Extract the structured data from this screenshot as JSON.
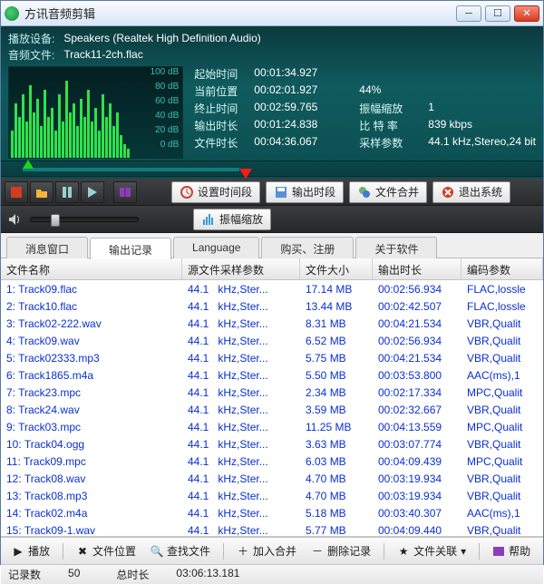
{
  "window": {
    "title": "方讯音频剪辑"
  },
  "device": {
    "play_label": "播放设备:",
    "play_value": "Speakers (Realtek High Definition Audio)",
    "file_label": "音频文件:",
    "file_value": "Track11-2ch.flac"
  },
  "db_labels": [
    "100 dB",
    "80 dB",
    "60 dB",
    "40 dB",
    "20 dB",
    "0 dB"
  ],
  "kv": {
    "start_k": "起始时间",
    "start_v": "00:01:34.927",
    "pos_k": "当前位置",
    "pos_v": "00:02:01.927",
    "pct_v": "44%",
    "end_k": "终止时间",
    "end_v": "00:02:59.765",
    "amp_k": "振幅缩放",
    "amp_v": "1",
    "out_k": "输出时长",
    "out_v": "00:01:24.838",
    "br_k": "比 特 率",
    "br_v": "839 kbps",
    "len_k": "文件时长",
    "len_v": "00:04:36.067",
    "samp_k": "采样参数",
    "samp_v": "44.1  kHz,Stereo,24 bit"
  },
  "menu": {
    "settime": "设置时间段",
    "outseg": "输出时段",
    "merge": "文件合并",
    "exit": "退出系统",
    "amp": "振幅缩放"
  },
  "tabs": [
    "消息窗口",
    "输出记录",
    "Language",
    "购买、注册",
    "关于软件"
  ],
  "cols": {
    "name": "文件名称",
    "src": "源文件采样参数",
    "size": "文件大小",
    "dur": "输出时长",
    "enc": "编码参数"
  },
  "rows": [
    {
      "i": "1:",
      "n": "Track09.flac",
      "hz": "44.1",
      "fmt": "kHz,Ster...",
      "sz": "17.14 MB",
      "d": "00:02:56.934",
      "e": "FLAC,lossle"
    },
    {
      "i": "2:",
      "n": "Track10.flac",
      "hz": "44.1",
      "fmt": "kHz,Ster...",
      "sz": "13.44 MB",
      "d": "00:02:42.507",
      "e": "FLAC,lossle"
    },
    {
      "i": "3:",
      "n": "Track02-222.wav",
      "hz": "44.1",
      "fmt": "kHz,Ster...",
      "sz": "8.31 MB",
      "d": "00:04:21.534",
      "e": "VBR,Qualit"
    },
    {
      "i": "4:",
      "n": "Track09.wav",
      "hz": "44.1",
      "fmt": "kHz,Ster...",
      "sz": "6.52 MB",
      "d": "00:02:56.934",
      "e": "VBR,Qualit"
    },
    {
      "i": "5:",
      "n": "Track02333.mp3",
      "hz": "44.1",
      "fmt": "kHz,Ster...",
      "sz": "5.75 MB",
      "d": "00:04:21.534",
      "e": "VBR,Qualit"
    },
    {
      "i": "6:",
      "n": "Track1865.m4a",
      "hz": "44.1",
      "fmt": "kHz,Ster...",
      "sz": "5.50 MB",
      "d": "00:03:53.800",
      "e": "AAC(ms),1"
    },
    {
      "i": "7:",
      "n": "Track23.mpc",
      "hz": "44.1",
      "fmt": "kHz,Ster...",
      "sz": "2.34 MB",
      "d": "00:02:17.334",
      "e": "MPC,Qualit"
    },
    {
      "i": "8:",
      "n": "Track24.wav",
      "hz": "44.1",
      "fmt": "kHz,Ster...",
      "sz": "3.59 MB",
      "d": "00:02:32.667",
      "e": "VBR,Qualit"
    },
    {
      "i": "9:",
      "n": "Track03.mpc",
      "hz": "44.1",
      "fmt": "kHz,Ster...",
      "sz": "11.25 MB",
      "d": "00:04:13.559",
      "e": "MPC,Qualit"
    },
    {
      "i": "10:",
      "n": "Track04.ogg",
      "hz": "44.1",
      "fmt": "kHz,Ster...",
      "sz": "3.63 MB",
      "d": "00:03:07.774",
      "e": "VBR,Qualit"
    },
    {
      "i": "11:",
      "n": "Track09.mpc",
      "hz": "44.1",
      "fmt": "kHz,Ster...",
      "sz": "6.03 MB",
      "d": "00:04:09.439",
      "e": "MPC,Qualit"
    },
    {
      "i": "12:",
      "n": "Track08.wav",
      "hz": "44.1",
      "fmt": "kHz,Ster...",
      "sz": "4.70 MB",
      "d": "00:03:19.934",
      "e": "VBR,Qualit"
    },
    {
      "i": "13:",
      "n": "Track08.mp3",
      "hz": "44.1",
      "fmt": "kHz,Ster...",
      "sz": "4.70 MB",
      "d": "00:03:19.934",
      "e": "VBR,Qualit"
    },
    {
      "i": "14:",
      "n": "Track02.m4a",
      "hz": "44.1",
      "fmt": "kHz,Ster...",
      "sz": "5.18 MB",
      "d": "00:03:40.307",
      "e": "AAC(ms),1"
    },
    {
      "i": "15:",
      "n": "Track09-1.wav",
      "hz": "44.1",
      "fmt": "kHz,Ster...",
      "sz": "5.77 MB",
      "d": "00:04:09.440",
      "e": "VBR,Qualit"
    }
  ],
  "bottom": {
    "play": "播放",
    "locate": "文件位置",
    "find": "查找文件",
    "addmerge": "加入合并",
    "del": "删除记录",
    "assoc": "文件关联",
    "help": "帮助"
  },
  "status": {
    "count_k": "记录数",
    "count_v": "50",
    "total_k": "总时长",
    "total_v": "03:06:13.181"
  }
}
